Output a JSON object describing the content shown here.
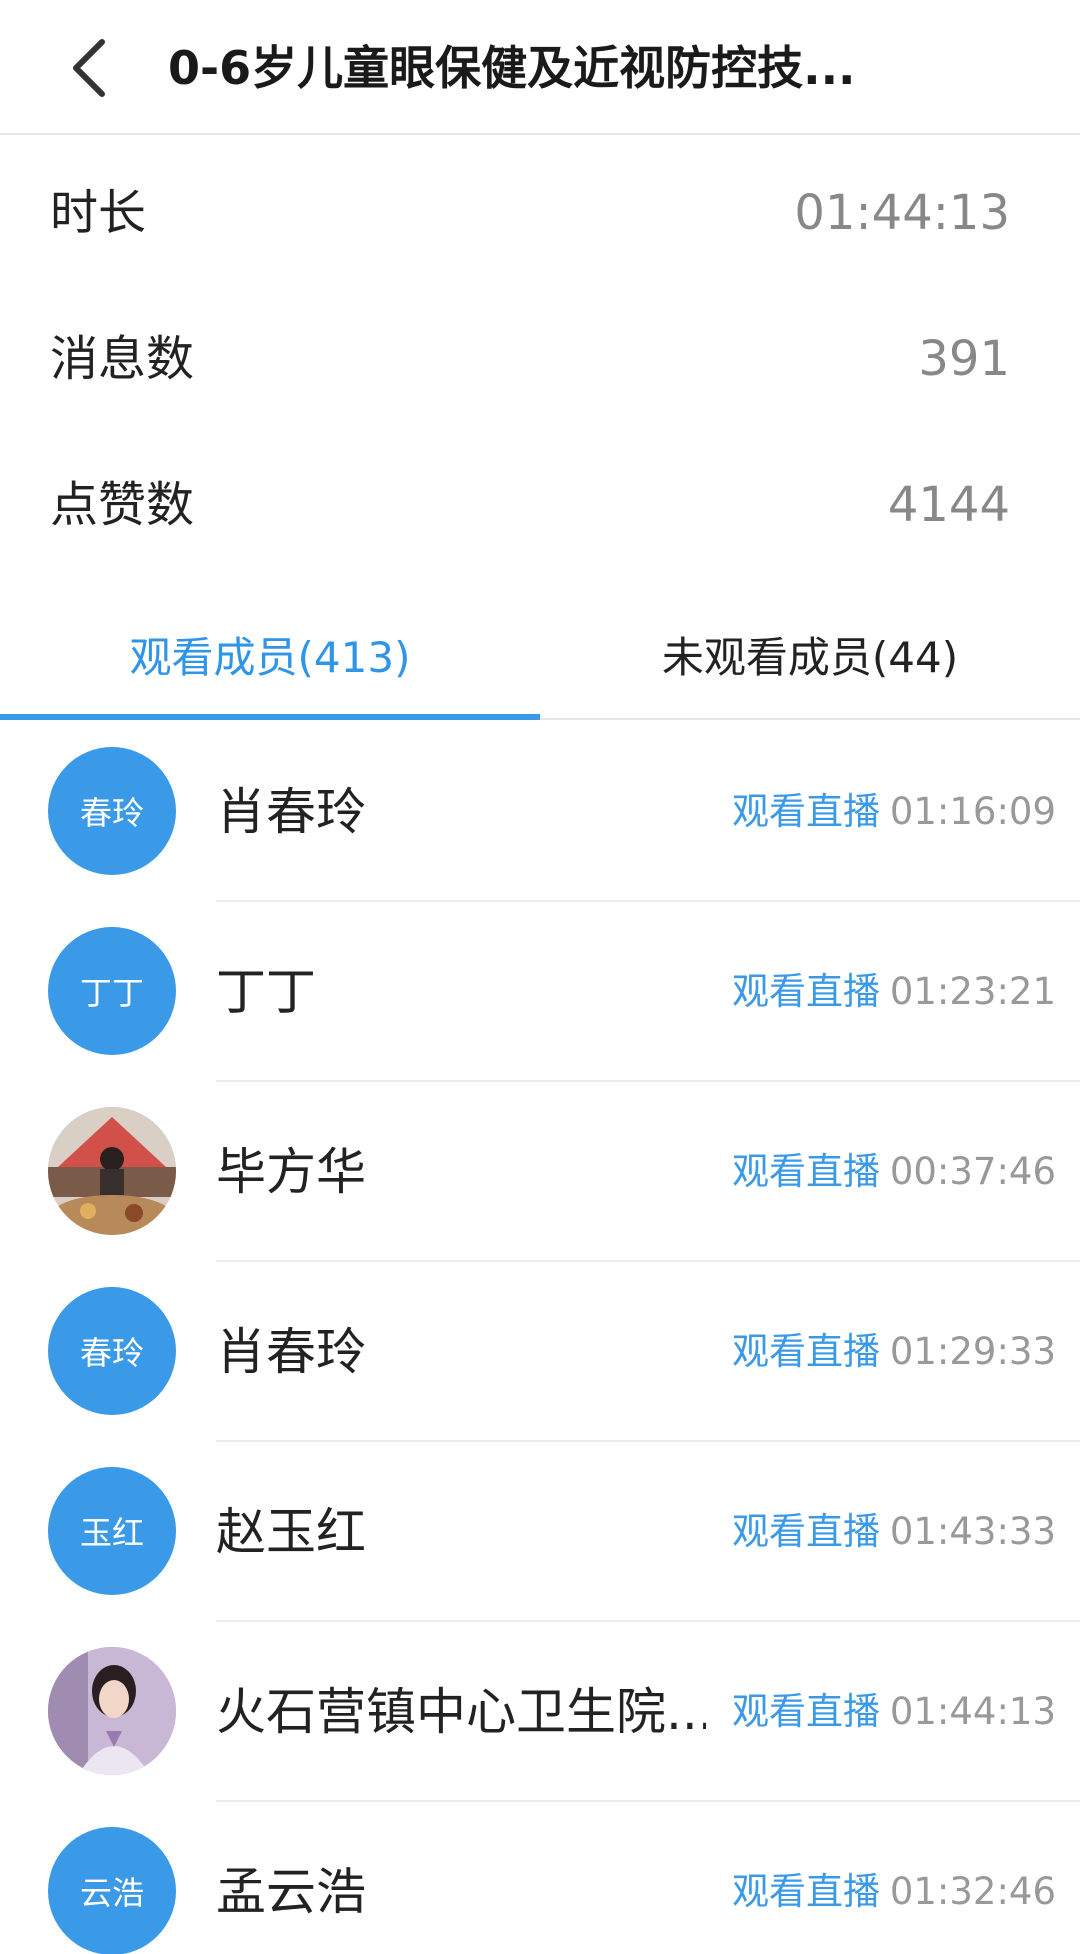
{
  "header": {
    "title": "0-6岁儿童眼保健及近视防控技..."
  },
  "stats": [
    {
      "label": "时长",
      "value": "01:44:13"
    },
    {
      "label": "消息数",
      "value": "391"
    },
    {
      "label": "点赞数",
      "value": "4144"
    }
  ],
  "tabs": [
    {
      "label": "观看成员(413)",
      "active": true
    },
    {
      "label": "未观看成员(44)",
      "active": false
    }
  ],
  "members": [
    {
      "avatar_text": "春玲",
      "name": "肖春玲",
      "action": "观看直播",
      "time": "01:16:09"
    },
    {
      "avatar_text": "丁丁",
      "name": "丁丁",
      "action": "观看直播",
      "time": "01:23:21"
    },
    {
      "avatar_text": "",
      "avatar_icon": "photo-avatar-icon",
      "name": "毕方华",
      "action": "观看直播",
      "time": "00:37:46"
    },
    {
      "avatar_text": "春玲",
      "name": "肖春玲",
      "action": "观看直播",
      "time": "01:29:33"
    },
    {
      "avatar_text": "玉红",
      "name": "赵玉红",
      "action": "观看直播",
      "time": "01:43:33"
    },
    {
      "avatar_text": "",
      "avatar_icon": "photo-avatar-icon",
      "name": "火石营镇中心卫生院...",
      "action": "观看直播",
      "time": "01:44:13"
    },
    {
      "avatar_text": "云浩",
      "name": "孟云浩",
      "action": "观看直播",
      "time": "01:32:46"
    }
  ],
  "colors": {
    "accent": "#3b9ae8",
    "time_gray": "#999999",
    "value_gray": "#888888"
  }
}
